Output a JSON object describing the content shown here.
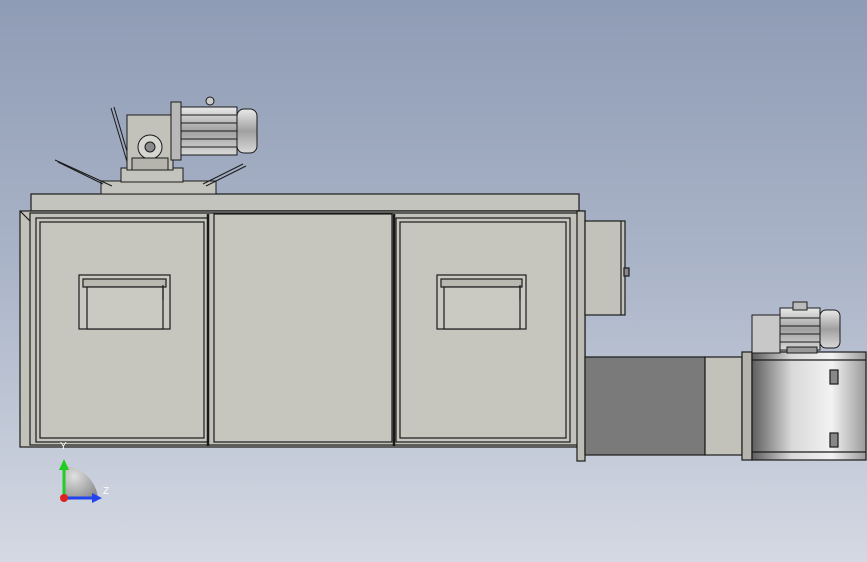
{
  "viewport": {
    "background_top": "#8f9cb5",
    "background_bottom": "#d4d9e3",
    "model_color": "#c2c2bb",
    "edge_color": "#1a1a1a",
    "duct_color": "#7a7a7a"
  },
  "triad": {
    "y_label": "Y",
    "z_label": "Z",
    "y_color": "#22cc22",
    "z_color": "#2244ee",
    "origin_color": "#dd2222"
  },
  "icons": [
    "gear-motor-icon",
    "fan-motor-icon",
    "axis-triad-icon"
  ]
}
